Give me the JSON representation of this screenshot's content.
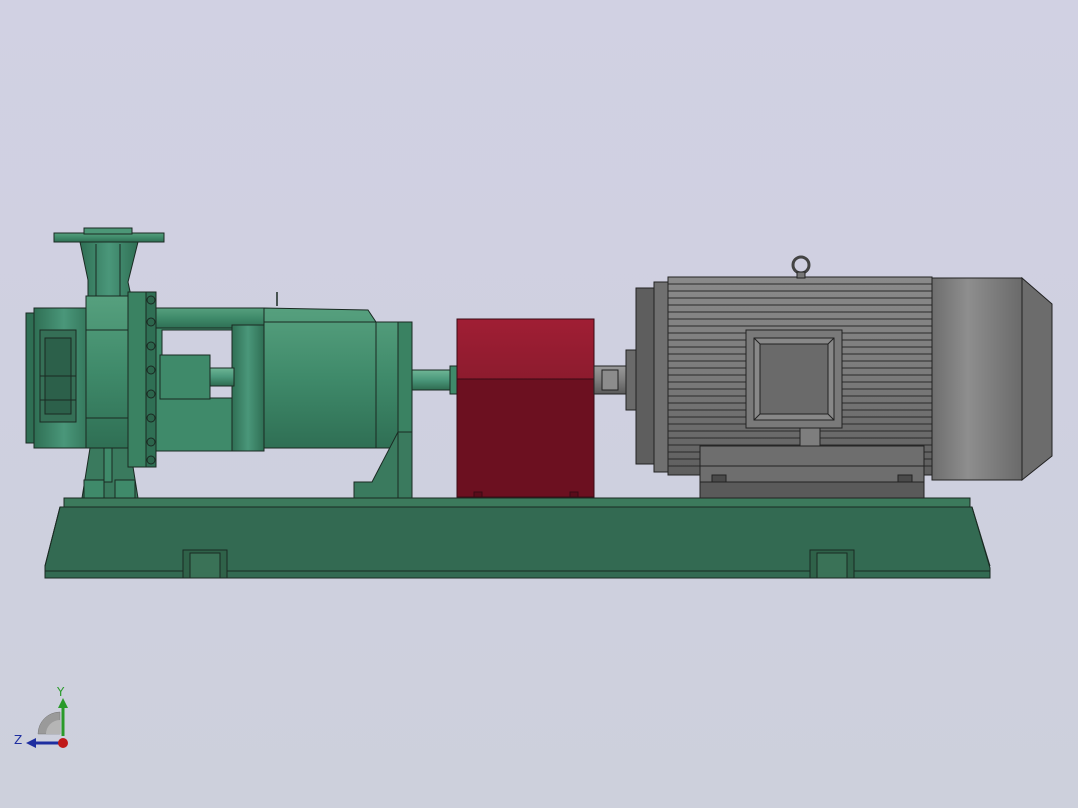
{
  "viewport": {
    "background": "#cfd0e0"
  },
  "colors": {
    "pump_green": "#3f8a6a",
    "base_green": "#336a52",
    "guard_red": "#8c1a2c",
    "motor_grey": "#7a7a7a",
    "outline": "#1a2a22"
  },
  "triad": {
    "y_label": "Y",
    "z_label": "Z",
    "y_color": "#2a9a2a",
    "z_color": "#1e2ea0",
    "x_color": "#c01818"
  },
  "icons": {
    "pump": "centrifugal-pump-icon",
    "guard": "coupling-guard-icon",
    "motor": "electric-motor-icon",
    "base": "baseplate-icon",
    "triad": "orientation-triad-icon"
  }
}
